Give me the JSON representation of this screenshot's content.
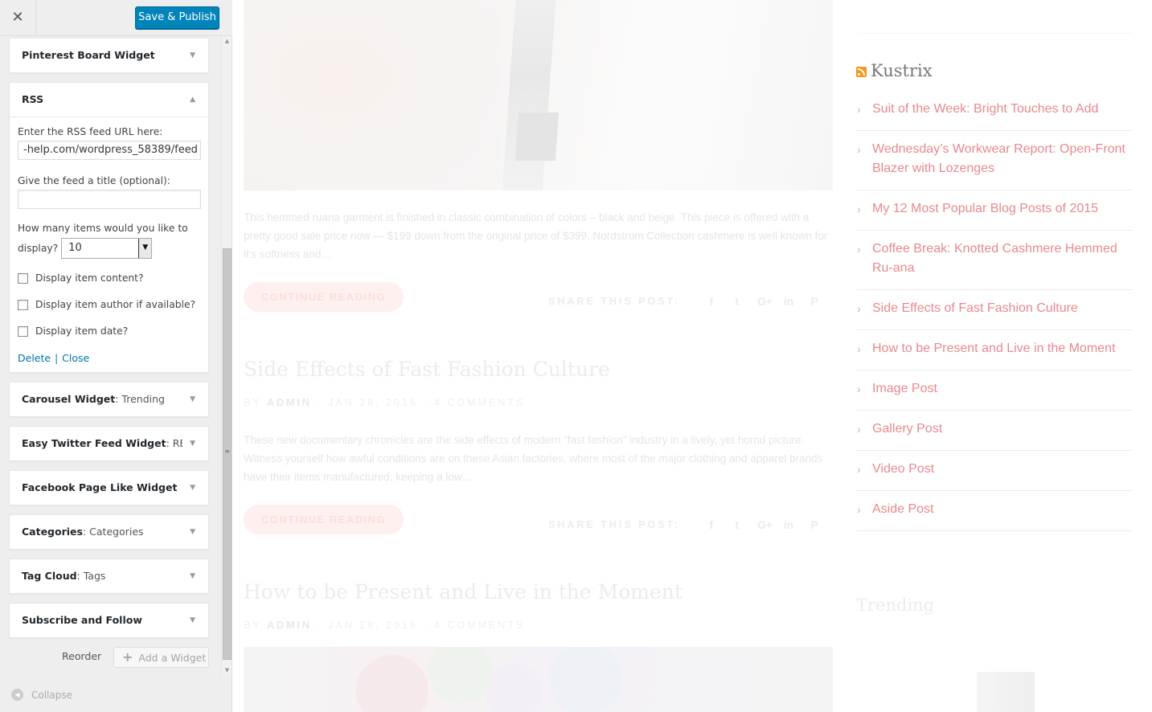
{
  "header": {
    "close_glyph": "✕",
    "save_label": "Save & Publish"
  },
  "widgets": {
    "pinterest": {
      "title": "Pinterest Board Widget"
    },
    "rss": {
      "title": "RSS",
      "url_label": "Enter the RSS feed URL here:",
      "url_value": "-help.com/wordpress_58389/feed",
      "title_label": "Give the feed a title (optional):",
      "title_value": "",
      "count_label_1": "How many items would you like to",
      "count_label_2": "display?",
      "count_value": "10",
      "opt_content": "Display item content?",
      "opt_author": "Display item author if available?",
      "opt_date": "Display item date?",
      "delete": "Delete",
      "close": "Close"
    },
    "carousel": {
      "title": "Carousel Widget",
      "subtitle": ": Trending"
    },
    "twitter": {
      "title": "Easy Twitter Feed Widget",
      "subtitle": ": RE..."
    },
    "facebook": {
      "title": "Facebook Page Like Widget"
    },
    "categories": {
      "title": "Categories",
      "subtitle": ": Categories"
    },
    "tagcloud": {
      "title": "Tag Cloud",
      "subtitle": ": Tags"
    },
    "subscribe": {
      "title": "Subscribe and Follow"
    }
  },
  "footer": {
    "reorder": "Reorder",
    "add_widget": "Add a Widget",
    "collapse": "Collapse"
  },
  "preview": {
    "excerpt_1": "This hemmed ruana garment is finished in classic combination of colors – black and beige. This piece is offered with a pretty good sale price now — $199 down from the original price of $399.  Nordstrom Collection cashmere is well known for it's softness and…",
    "continue": "CONTINUE READING",
    "share": "SHARE THIS POST:",
    "post2_title": "Side Effects of Fast Fashion Culture",
    "post2_meta_by": "BY",
    "post2_meta_author": "ADMIN",
    "post2_meta_date": "JAN 28, 2016",
    "post2_meta_comments": "4 COMMENTS",
    "excerpt_2": "These new documentary chronicles are the side effects of modern “fast fashion” industry in a lively, yet horrid picture. Witness yourself how awful conditions are on these Asian factories, where most of the major clothing and apparel brands have their items manufactured, keeping a low…",
    "post3_title": "How to be Present and Live in the Moment",
    "post3_meta_by": "BY",
    "post3_meta_author": "ADMIN",
    "post3_meta_date": "JAN 28, 2016",
    "post3_meta_comments": "4 COMMENTS",
    "sidebar_rss_title": "Kustrix",
    "rss_items": [
      "Suit of the Week: Bright Touches to Add",
      "Wednesday’s Workwear Report: Open-Front Blazer with Lozenges",
      "My 12 Most Popular Blog Posts of 2015",
      "Coffee Break: Knotted Cashmere Hemmed Ru-ana",
      "Side Effects of Fast Fashion Culture",
      "How to be Present and Live in the Moment",
      "Image Post",
      "Gallery Post",
      "Video Post",
      "Aside Post"
    ],
    "trending_title": "Trending"
  },
  "icons": {
    "share": [
      "facebook-icon",
      "twitter-icon",
      "google-plus-icon",
      "linkedin-icon",
      "pinterest-icon"
    ],
    "rss": "rss-icon",
    "collapse": "collapse-arrow-icon"
  },
  "colors": {
    "primary_button": "#0085ba",
    "link": "#0073aa",
    "rss_link": "#e8898d",
    "rss_icon": "#f8961e"
  }
}
